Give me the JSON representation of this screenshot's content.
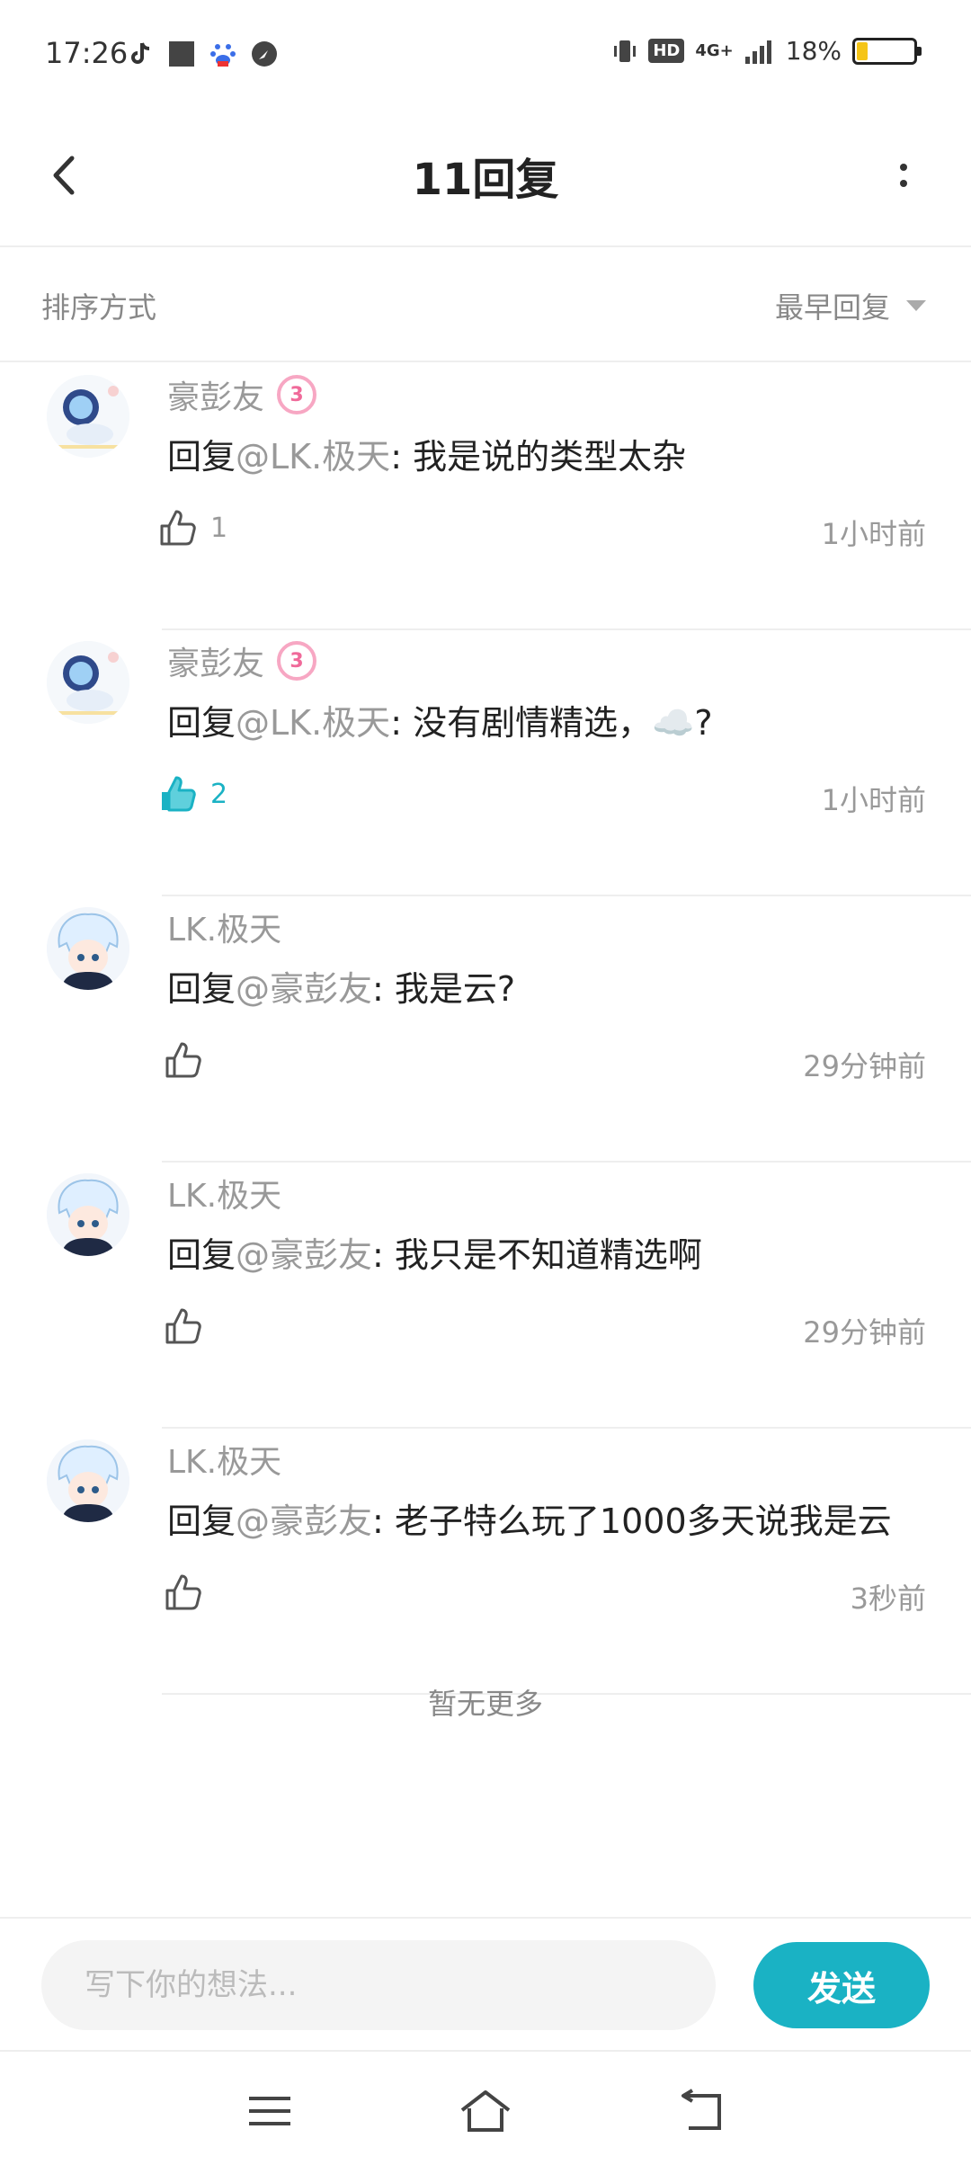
{
  "status_bar": {
    "time": "17:26",
    "network": "4G+",
    "hd": "HD",
    "battery_percent": "18%",
    "battery_level": 0.18
  },
  "header": {
    "title": "11回复"
  },
  "sort": {
    "label": "排序方式",
    "selected": "最早回复"
  },
  "comments": [
    {
      "user": "豪彭友",
      "level": "3",
      "reply_prefix": "回复",
      "mention": "@LK.极天",
      "text": ": 我是说的类型太杂",
      "likes": "1",
      "liked": false,
      "time": "1小时前"
    },
    {
      "user": "豪彭友",
      "level": "3",
      "reply_prefix": "回复",
      "mention": "@LK.极天",
      "text": ": 没有剧情精选，☁️?",
      "likes": "2",
      "liked": true,
      "time": "1小时前"
    },
    {
      "user": "LK.极天",
      "reply_prefix": "回复",
      "mention": "@豪彭友",
      "text": ": 我是云?",
      "likes": "",
      "liked": false,
      "time": "29分钟前"
    },
    {
      "user": "LK.极天",
      "reply_prefix": "回复",
      "mention": "@豪彭友",
      "text": ": 我只是不知道精选啊",
      "likes": "",
      "liked": false,
      "time": "29分钟前"
    },
    {
      "user": "LK.极天",
      "reply_prefix": "回复",
      "mention": "@豪彭友",
      "text": ": 老子特么玩了1000多天说我是云",
      "likes": "",
      "liked": false,
      "time": "3秒前"
    }
  ],
  "no_more": "暂无更多",
  "input": {
    "placeholder": "写下你的想法...",
    "value": ""
  },
  "send_label": "发送",
  "colors": {
    "accent": "#1ab2c4",
    "muted_text": "#999999",
    "badge_pink": "#f06a9a"
  }
}
